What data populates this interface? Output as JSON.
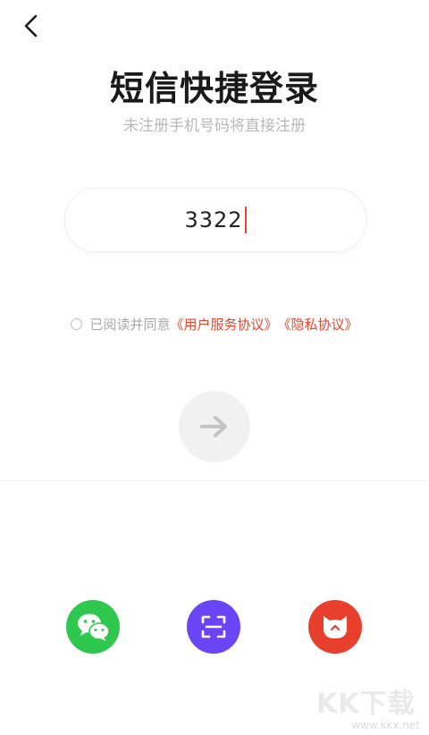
{
  "page": {
    "title": "短信快捷登录",
    "subtitle": "未注册手机号码将直接注册"
  },
  "phone_input": {
    "value": "3322"
  },
  "agreement": {
    "prefix": "已阅读并同意",
    "user_agreement": "《用户服务协议》",
    "privacy_policy": "《隐私协议》",
    "checked": false
  },
  "next_button": {
    "icon": "arrow-right-icon",
    "enabled": false
  },
  "third_party_login": [
    {
      "name": "wechat",
      "icon": "wechat-icon",
      "color": "#2dc84d"
    },
    {
      "name": "scan",
      "icon": "scan-icon",
      "color": "#6a45f5"
    },
    {
      "name": "cat",
      "icon": "cat-icon",
      "color": "#e8402d"
    }
  ],
  "watermark": {
    "mark": "KK下载",
    "url": "www.kkx.net"
  },
  "colors": {
    "accent": "#e8452c",
    "muted_text": "#b8b8b8"
  }
}
